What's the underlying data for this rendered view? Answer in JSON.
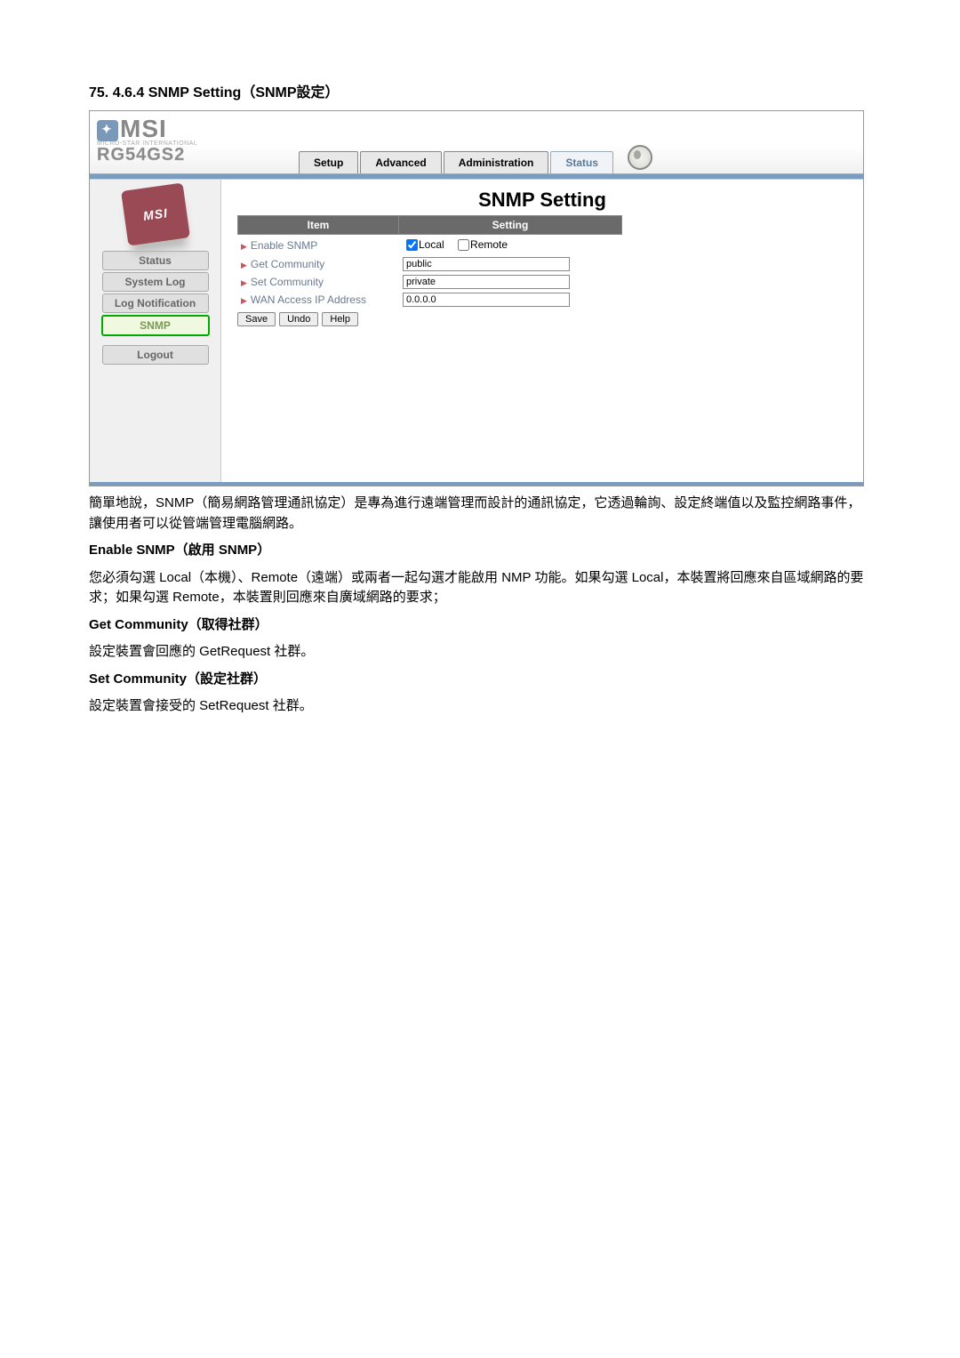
{
  "heading": "75.   4.6.4 SNMP Setting（SNMP設定）",
  "logo": {
    "main": "MSI",
    "tagline": "MICRO-STAR INTERNATIONAL",
    "model": "RG54GS2",
    "badge": "MSI"
  },
  "nav": {
    "setup": "Setup",
    "advanced": "Advanced",
    "administration": "Administration",
    "status": "Status"
  },
  "sidebar": {
    "status": "Status",
    "system_log": "System Log",
    "log_notification": "Log Notification",
    "snmp": "SNMP",
    "logout": "Logout"
  },
  "panel": {
    "title": "SNMP Setting",
    "col_item": "Item",
    "col_setting": "Setting",
    "rows": {
      "enable_snmp": "Enable SNMP",
      "get_community": "Get Community",
      "set_community": "Set Community",
      "wan_access": "WAN Access IP Address"
    },
    "settings": {
      "local_label": "Local",
      "remote_label": "Remote",
      "get_value": "public",
      "set_value": "private",
      "wan_value": "0.0.0.0"
    },
    "actions": {
      "save": "Save",
      "undo": "Undo",
      "help": "Help"
    }
  },
  "prose": {
    "intro": "簡單地說，SNMP（簡易網路管理通訊協定）是專為進行遠端管理而設計的通訊協定，它透過輪詢、設定終端值以及監控網路事件，讓使用者可以從管端管理電腦網路。",
    "enable_head": "Enable SNMP（啟用 SNMP）",
    "enable_body": "您必須勾選 Local（本機）、Remote（遠端）或兩者一起勾選才能啟用 NMP 功能。如果勾選 Local，本裝置將回應來自區域網路的要求；如果勾選 Remote，本裝置則回應來自廣域網路的要求；",
    "get_head": "Get Community（取得社群）",
    "get_body": "設定裝置會回應的 GetRequest 社群。",
    "set_head": "Set Community（設定社群）",
    "set_body": "設定裝置會接受的 SetRequest 社群。"
  }
}
